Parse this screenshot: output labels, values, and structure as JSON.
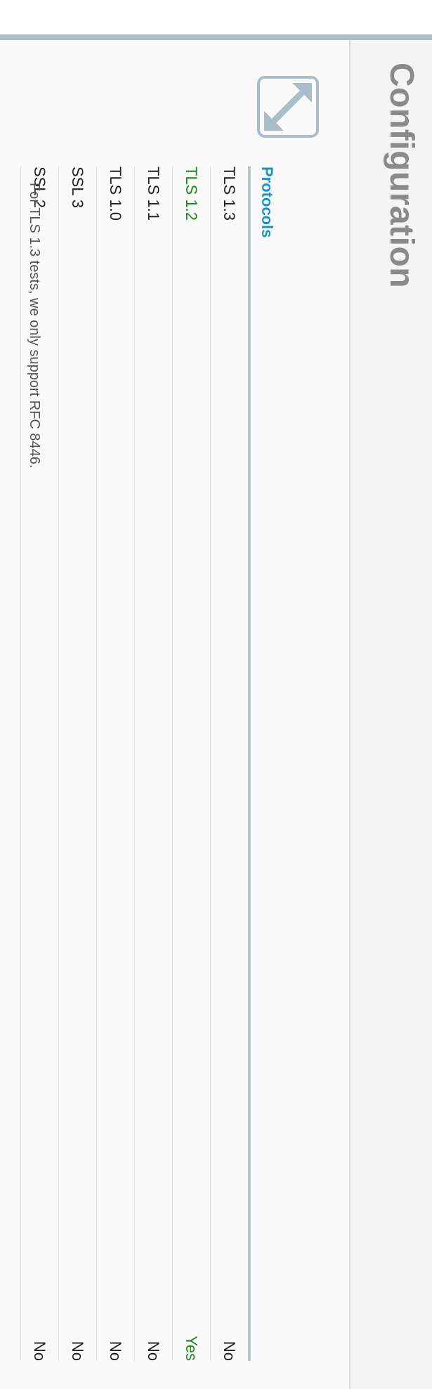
{
  "header": {
    "title": "Configuration"
  },
  "icons": {
    "expand": "expand-icon"
  },
  "protocols": {
    "heading": "Protocols",
    "rows": [
      {
        "name": "TLS 1.3",
        "value": "No",
        "status": "neutral"
      },
      {
        "name": "TLS 1.2",
        "value": "Yes",
        "status": "good"
      },
      {
        "name": "TLS 1.1",
        "value": "No",
        "status": "neutral"
      },
      {
        "name": "TLS 1.0",
        "value": "No",
        "status": "neutral"
      },
      {
        "name": "SSL 3",
        "value": "No",
        "status": "neutral"
      },
      {
        "name": "SSL 2",
        "value": "No",
        "status": "neutral"
      }
    ]
  },
  "note": "For TLS 1.3 tests, we only support RFC 8446.",
  "colors": {
    "heading_blue": "#1a91d1",
    "good_green": "#188a18",
    "title_gray": "#8a8a8a",
    "bar_teal": "#a9bec6"
  }
}
